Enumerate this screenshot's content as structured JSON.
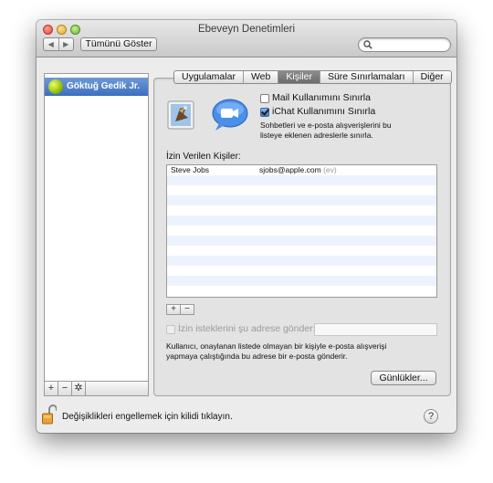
{
  "window": {
    "title": "Ebeveyn Denetimleri",
    "show_all": "Tümünü Göster",
    "nav_back": "◀",
    "nav_forward": "▶"
  },
  "search": {
    "placeholder": ""
  },
  "sidebar": {
    "users": [
      {
        "name": "Göktuğ Gedik Jr.",
        "selected": true
      }
    ],
    "add": "+",
    "remove": "−",
    "action": "✲"
  },
  "tabs": [
    {
      "label": "Uygulamalar",
      "selected": false
    },
    {
      "label": "Web",
      "selected": false
    },
    {
      "label": "Kişiler",
      "selected": true
    },
    {
      "label": "Süre Sınırlamaları",
      "selected": false
    },
    {
      "label": "Diğer",
      "selected": false
    }
  ],
  "contacts": {
    "mail_limit": {
      "label": "Mail Kullanımını Sınırla",
      "checked": false
    },
    "ichat_limit": {
      "label": "iChat Kullanımını Sınırla",
      "checked": true
    },
    "description_line1": "Sohbetleri ve e-posta alışverişlerini bu",
    "description_line2": "listeye eklenen adreslerle sınırla.",
    "allowed_title": "İzin Verilen Kişiler:",
    "rows": [
      {
        "name": "Steve Jobs",
        "email": "sjobs@apple.com",
        "type": "(ev)"
      }
    ],
    "add": "+",
    "remove": "−",
    "send_permission": {
      "label": "İzin isteklerini şu adrese gönder:",
      "checked": false,
      "enabled": false,
      "value": ""
    },
    "info_line1": "Kullanıcı, onaylanan listede olmayan bir kişiyle e-posta alışverişi",
    "info_line2": "yapmaya çalıştığında bu adrese bir e-posta gönderir.",
    "logs_button": "Günlükler..."
  },
  "footer": {
    "lock_text": "Değişiklikleri engellemek için kilidi tıklayın.",
    "help": "?"
  },
  "colors": {
    "selection_blue": "#3c6fbf",
    "row_alt": "#edf3fe",
    "window_bg": "#ececec"
  }
}
